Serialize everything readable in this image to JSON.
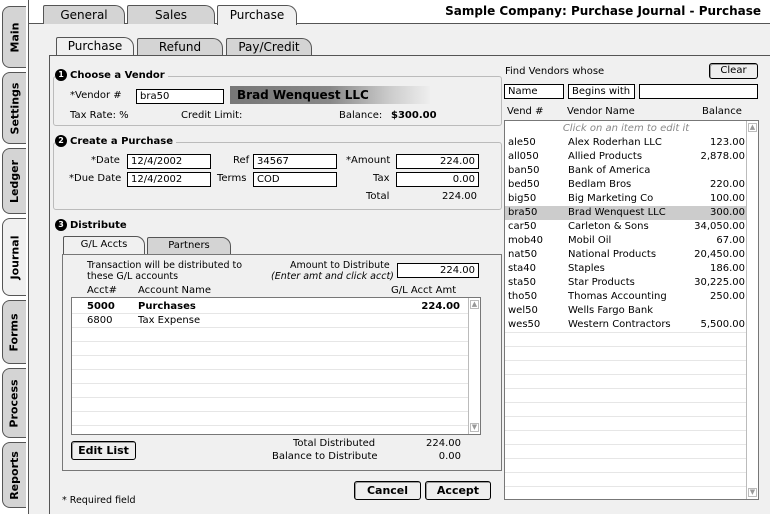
{
  "left_nav": [
    "Main",
    "Settings",
    "Ledger",
    "Journal",
    "Forms",
    "Process",
    "Reports"
  ],
  "top_tabs": [
    "General",
    "Sales",
    "Purchase"
  ],
  "app_title": "Sample Company: Purchase Journal - Purchase",
  "sub_tabs": [
    "Purchase",
    "Refund",
    "Pay/Credit"
  ],
  "choose_vendor": {
    "num": "1",
    "title": "Choose a Vendor",
    "vendor_label": "*Vendor #",
    "vendor_value": "bra50",
    "vendor_name": "Brad Wenquest LLC",
    "tax_rate_label": "Tax Rate: %",
    "credit_limit_label": "Credit Limit:",
    "balance_label": "Balance:",
    "balance_value": "$300.00"
  },
  "create_purchase": {
    "num": "2",
    "title": "Create a Purchase",
    "date_label": "*Date",
    "date_value": "12/4/2002",
    "ref_label": "Ref",
    "ref_value": "34567",
    "amount_label": "*Amount",
    "amount_value": "224.00",
    "due_label": "*Due Date",
    "due_value": "12/4/2002",
    "terms_label": "Terms",
    "terms_value": "COD",
    "tax_label": "Tax",
    "tax_value": "0.00",
    "total_label": "Total",
    "total_value": "224.00"
  },
  "distribute": {
    "num": "3",
    "title": "Distribute",
    "tabs": [
      "G/L Accts",
      "Partners"
    ],
    "note_line1": "Transaction will be distributed to",
    "note_line2": "these G/L accounts",
    "amt_label1": "Amount to Distribute",
    "amt_label2": "(Enter amt and click acct)",
    "amt_value": "224.00",
    "col_acct": "Acct#",
    "col_name": "Account Name",
    "col_amt": "G/L Acct Amt",
    "rows": [
      {
        "acct": "5000",
        "name": "Purchases",
        "amt": "224.00"
      },
      {
        "acct": "6800",
        "name": "Tax Expense",
        "amt": ""
      }
    ],
    "edit_list": "Edit List",
    "total_distributed_label": "Total Distributed",
    "total_distributed_value": "224.00",
    "balance_label": "Balance to Distribute",
    "balance_value": "0.00"
  },
  "required_note": "* Required field",
  "cancel_label": "Cancel",
  "accept_label": "Accept",
  "find": {
    "label": "Find Vendors whose",
    "clear_label": "Clear",
    "field_value": "Name",
    "mode_value": "Begins with",
    "query_value": "",
    "col_vend": "Vend #",
    "col_name": "Vendor Name",
    "col_bal": "Balance",
    "hint": "Click on an item to edit it",
    "vendors": [
      {
        "id": "ale50",
        "name": "Alex Roderhan LLC",
        "bal": "123.00"
      },
      {
        "id": "all050",
        "name": "Allied Products",
        "bal": "2,878.00"
      },
      {
        "id": "ban50",
        "name": "Bank of America",
        "bal": ""
      },
      {
        "id": "bed50",
        "name": "Bedlam Bros",
        "bal": "220.00"
      },
      {
        "id": "big50",
        "name": "Big Marketing Co",
        "bal": "100.00"
      },
      {
        "id": "bra50",
        "name": "Brad Wenquest LLC",
        "bal": "300.00"
      },
      {
        "id": "car50",
        "name": "Carleton & Sons",
        "bal": "34,050.00"
      },
      {
        "id": "mob40",
        "name": "Mobil Oil",
        "bal": "67.00"
      },
      {
        "id": "nat50",
        "name": "National Products",
        "bal": "20,450.00"
      },
      {
        "id": "sta40",
        "name": "Staples",
        "bal": "186.00"
      },
      {
        "id": "sta50",
        "name": "Star Products",
        "bal": "30,225.00"
      },
      {
        "id": "tho50",
        "name": "Thomas Accounting",
        "bal": "250.00"
      },
      {
        "id": "wel50",
        "name": "Wells Fargo Bank",
        "bal": ""
      },
      {
        "id": "wes50",
        "name": "Western Contractors",
        "bal": "5,500.00"
      }
    ],
    "selected_index": 5
  }
}
